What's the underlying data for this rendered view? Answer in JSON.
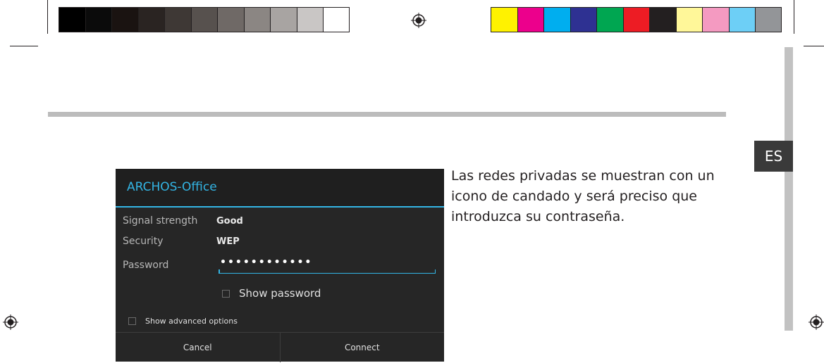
{
  "print_marks": {
    "grayscale_swatches": [
      "#000000",
      "#0b0b0b",
      "#1a1311",
      "#2a2422",
      "#3e3835",
      "#57514e",
      "#6f6966",
      "#8b8683",
      "#a8a4a2",
      "#c9c6c5",
      "#ffffff"
    ],
    "color_swatches": [
      "#fff200",
      "#ec008c",
      "#00aeef",
      "#2e3192",
      "#00a651",
      "#ed1c24",
      "#231f20",
      "#fff799",
      "#f49ac1",
      "#6dcff6",
      "#939598"
    ]
  },
  "language_tab": "ES",
  "dialog": {
    "title": "ARCHOS-Office",
    "signal_label": "Signal strength",
    "signal_value": "Good",
    "security_label": "Security",
    "security_value": "WEP",
    "password_label": "Password",
    "password_value": "••••••••••••",
    "show_password_label": "Show password",
    "show_advanced_label": "Show advanced options",
    "cancel_label": "Cancel",
    "connect_label": "Connect"
  },
  "body_text": "Las redes privadas se muestran con un icono de candado y será preciso que introduzca su contraseña.",
  "colors": {
    "accent": "#33b5e5",
    "dialog_bg": "#262626"
  }
}
